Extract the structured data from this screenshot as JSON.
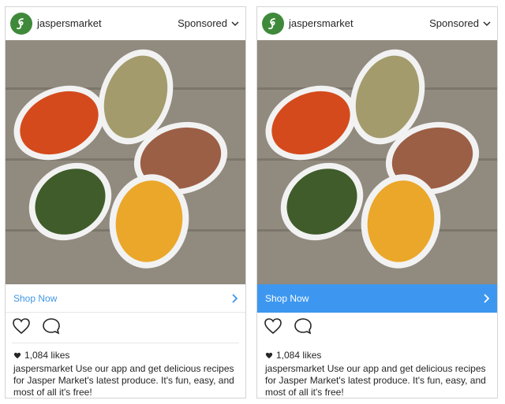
{
  "posts": [
    {
      "id": "left",
      "username": "jaspersmarket",
      "sponsored": "Sponsored",
      "cta": "Shop Now",
      "likes": "1,084 likes",
      "caption_user": "jaspersmarket",
      "caption_text": "Use our app and get delicious recipes for Jasper Market's latest produce. It's fun, easy, and most of all it's free!"
    },
    {
      "id": "right",
      "username": "jaspersmarket",
      "sponsored": "Sponsored",
      "cta": "Shop Now",
      "likes": "1,084 likes",
      "caption_user": "jaspersmarket",
      "caption_text": "Use our app and get delicious recipes for Jasper Market's latest produce. It's fun, easy, and most of all it's free!"
    }
  ],
  "icons": {
    "avatar": "jasper-logo-icon",
    "sponsored_menu": "chevron-down-icon",
    "cta_arrow": "chevron-right-icon",
    "like": "heart-outline-icon",
    "comment": "comment-bubble-icon",
    "likes_heart": "heart-filled-icon"
  },
  "colors": {
    "brand_green": "#3f8a3a",
    "link_blue": "#3f97e6",
    "cta_blue_fill": "#3d97f0"
  }
}
